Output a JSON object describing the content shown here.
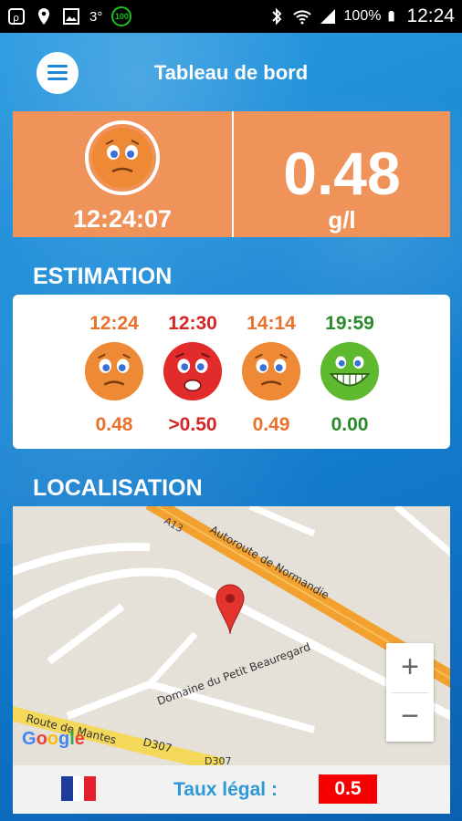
{
  "status_bar": {
    "left_icons": [
      "chat-icon",
      "location-icon",
      "image-icon",
      "bluetooth-small-icon"
    ],
    "temp": "3°",
    "badge": "100",
    "battery": "100%",
    "time": "12:24"
  },
  "header": {
    "title": "Tableau de bord"
  },
  "current": {
    "time": "12:24:07",
    "value": "0.48",
    "unit": "g/l",
    "mood": "worried"
  },
  "estimation": {
    "title": "ESTIMATION",
    "items": [
      {
        "time": "12:24",
        "value": "0.48",
        "mood": "worried",
        "color": "#e8722c"
      },
      {
        "time": "12:30",
        "value": ">0.50",
        "mood": "shocked",
        "color": "#d42525"
      },
      {
        "time": "14:14",
        "value": "0.49",
        "mood": "worried",
        "color": "#e8722c"
      },
      {
        "time": "19:59",
        "value": "0.00",
        "mood": "happy",
        "color": "#2a8a2a"
      }
    ]
  },
  "localisation": {
    "title": "LOCALISATION",
    "map_labels": {
      "a13": "A13",
      "autoroute": "Autoroute de Normandie",
      "domaine": "Domaine du Petit Beauregard",
      "route_mantes": "Route de Mantes",
      "d307": "D307",
      "d307b": "D307"
    },
    "google": "Google",
    "zoom_in": "+",
    "zoom_out": "−"
  },
  "bottom": {
    "taux_label": "Taux légal :",
    "taux_value": "0.5"
  },
  "colors": {
    "orange": "#f0935b",
    "red": "#f40000",
    "blue": "#2d9ad8"
  }
}
